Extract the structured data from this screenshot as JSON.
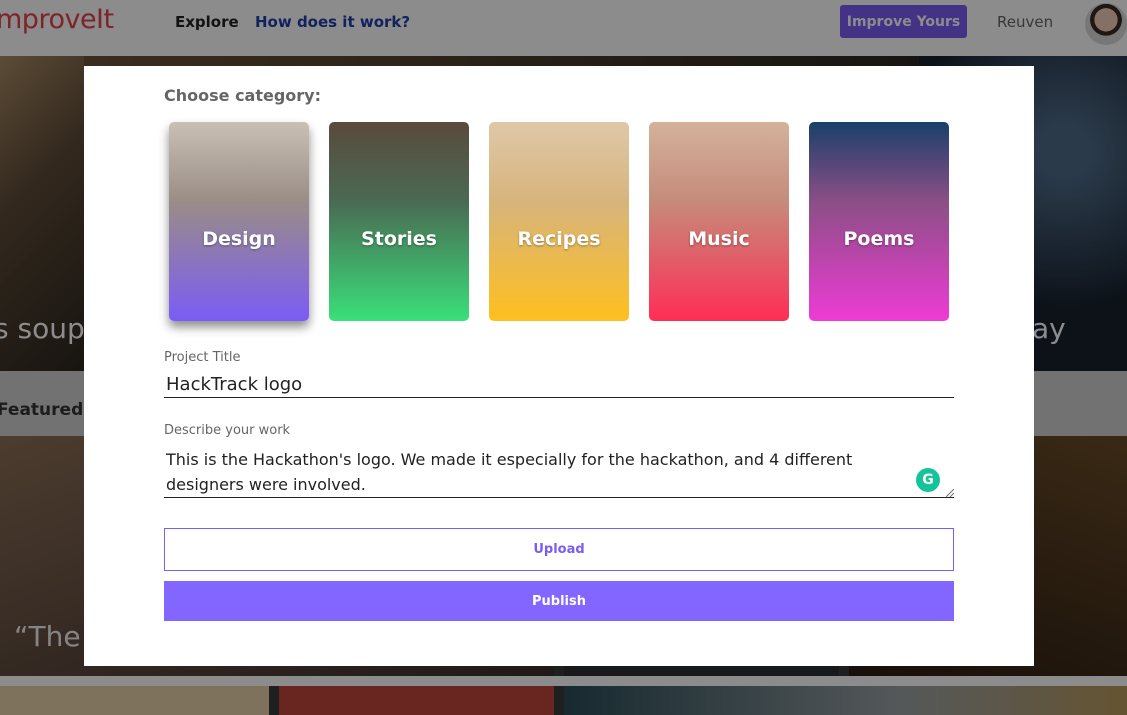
{
  "nav": {
    "logo": "mproveIt",
    "explore": "Explore",
    "how": "How does it work?",
    "improve_button": "Improve Yours",
    "user": "Reuven"
  },
  "background": {
    "hero_left_text": "s soup",
    "hero_right_text": "ay",
    "featured": "Featured",
    "quote_start": "“The V"
  },
  "modal": {
    "choose_label": "Choose category:",
    "categories": [
      {
        "label": "Design",
        "selected": true
      },
      {
        "label": "Stories",
        "selected": false
      },
      {
        "label": "Recipes",
        "selected": false
      },
      {
        "label": "Music",
        "selected": false
      },
      {
        "label": "Poems",
        "selected": false
      }
    ],
    "title_label": "Project Title",
    "title_value": "HackTrack logo",
    "desc_label": "Describe your work",
    "desc_value": "This is the Hackathon's logo. We made it especially for the hackathon, and 4 different designers were involved.",
    "upload_label": "Upload",
    "publish_label": "Publish"
  },
  "colors": {
    "accent": "#7b5cf5",
    "logo": "#e2434b",
    "grammarly": "#15c39a"
  }
}
